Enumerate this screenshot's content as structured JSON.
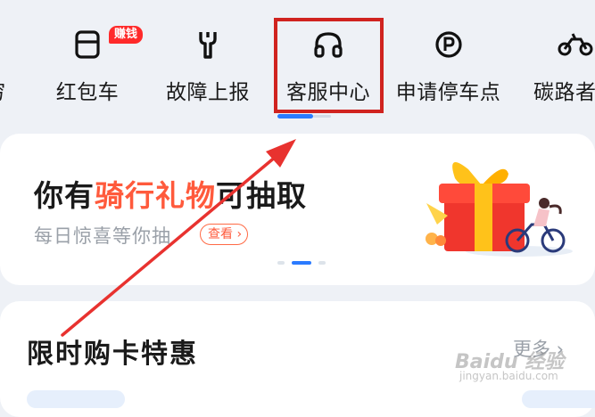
{
  "nav": {
    "items": [
      {
        "label": "穷"
      },
      {
        "label": "红包车",
        "badge": "赚钱"
      },
      {
        "label": "故障上报"
      },
      {
        "label": "客服中心"
      },
      {
        "label": "申请停车点"
      },
      {
        "label": "碳路者"
      }
    ]
  },
  "promo": {
    "title_prefix": "你有",
    "title_accent": "骑行礼物",
    "title_suffix": "可抽取",
    "subtitle": "每日惊喜等你抽",
    "button": "查看"
  },
  "section": {
    "title": "限时购卡特惠",
    "more": "更多"
  },
  "watermark": {
    "main": "Baidu 经验",
    "sub": "jingyan.baidu.com"
  },
  "colors": {
    "accent": "#ff5a3c",
    "highlight": "#d0231f",
    "tab_active": "#2b7bff",
    "annotation_arrow": "#e8322f"
  }
}
